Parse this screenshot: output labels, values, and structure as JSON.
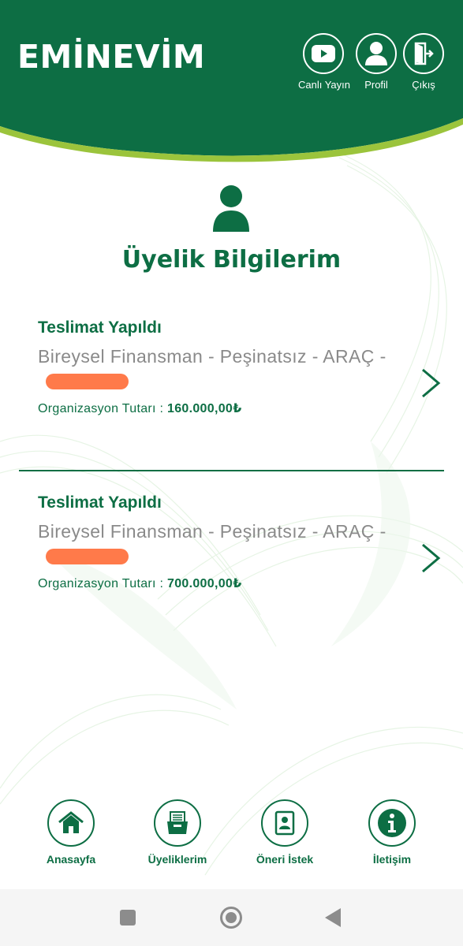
{
  "app": {
    "logo": "EMİNEVİM"
  },
  "colors": {
    "brand": "#0d6e44",
    "accent_line": "#9bc43c",
    "redaction": "#ff7a4a"
  },
  "header": {
    "buttons": [
      {
        "label": "Canlı Yayın",
        "icon": "youtube-play-icon"
      },
      {
        "label": "Profil",
        "icon": "user-icon"
      },
      {
        "label": "Çıkış",
        "icon": "logout-door-icon"
      }
    ]
  },
  "page": {
    "title": "Üyelik Bilgilerim",
    "icon": "user-icon"
  },
  "memberships": [
    {
      "status": "Teslimat Yapıldı",
      "plan": "Bireysel Finansman - Peşinatsız - ARAÇ -",
      "amount_label": "Organizasyon Tutarı : ",
      "amount_value": "160.000,00₺"
    },
    {
      "status": "Teslimat Yapıldı",
      "plan": "Bireysel Finansman - Peşinatsız - ARAÇ -",
      "amount_label": "Organizasyon Tutarı : ",
      "amount_value": "700.000,00₺"
    }
  ],
  "bottom_nav": [
    {
      "label": "Anasayfa",
      "icon": "home-icon"
    },
    {
      "label": "Üyeliklerim",
      "icon": "files-tray-icon"
    },
    {
      "label": "Öneri İstek",
      "icon": "contact-card-icon"
    },
    {
      "label": "İletişim",
      "icon": "info-icon"
    }
  ]
}
